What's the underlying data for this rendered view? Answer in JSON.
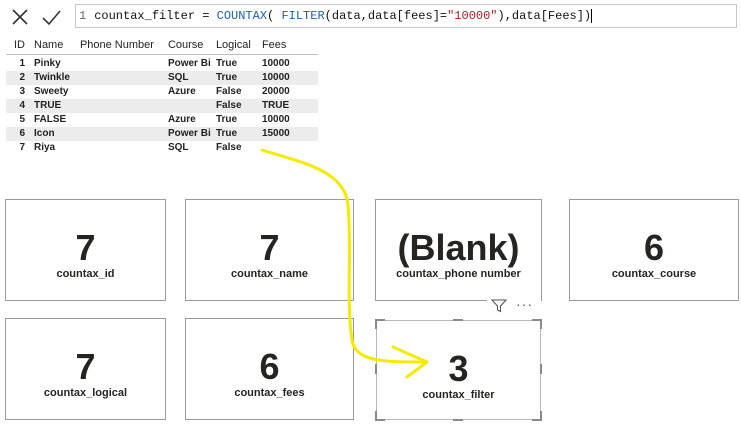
{
  "formula_bar": {
    "line_number": "1",
    "measure_name": "countax_filter = ",
    "fn_countax": "COUNTAX",
    "part_open": "( ",
    "fn_filter": "FILTER",
    "part_args": "(data,data[fees]=",
    "string_literal": "\"10000\"",
    "part_close": "),data[Fees])",
    "cancel_icon": "close-icon",
    "commit_icon": "checkmark-icon"
  },
  "table": {
    "headers": [
      "ID",
      "Name",
      "Phone Number",
      "Course",
      "Logical",
      "Fees"
    ],
    "rows": [
      [
        "1",
        "Pinky",
        "",
        "Power Bi",
        "True",
        "10000"
      ],
      [
        "2",
        "Twinkle",
        "",
        "SQL",
        "True",
        "10000"
      ],
      [
        "3",
        "Sweety",
        "",
        "Azure",
        "False",
        "20000"
      ],
      [
        "4",
        "TRUE",
        "",
        "",
        "False",
        "TRUE"
      ],
      [
        "5",
        "FALSE",
        "",
        "Azure",
        "True",
        "10000"
      ],
      [
        "6",
        "Icon",
        "",
        "Power Bi",
        "True",
        "15000"
      ],
      [
        "7",
        "Riya",
        "",
        "SQL",
        "False",
        ""
      ]
    ]
  },
  "cards": [
    {
      "value": "7",
      "label": "countax_id"
    },
    {
      "value": "7",
      "label": "countax_name"
    },
    {
      "value": "(Blank)",
      "label": "countax_phone number"
    },
    {
      "value": "6",
      "label": "countax_course"
    },
    {
      "value": "7",
      "label": "countax_logical"
    },
    {
      "value": "6",
      "label": "countax_fees"
    },
    {
      "value": "3",
      "label": "countax_filter"
    }
  ],
  "visual_header": {
    "filter_icon": "filter-icon",
    "more_label": "···"
  },
  "colors": {
    "annotation": "#f5ea00",
    "dax_function": "#1a5fb4",
    "dax_string": "#b02020"
  }
}
